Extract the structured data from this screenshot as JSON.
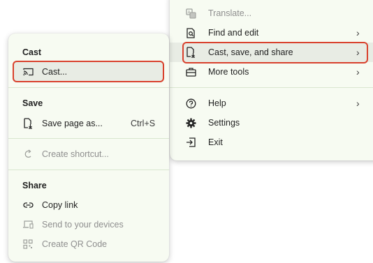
{
  "main_menu": {
    "items": [
      {
        "label": "Translate...",
        "icon": "translate-icon",
        "disabled": true
      },
      {
        "label": "Find and edit",
        "icon": "find-edit-icon",
        "submenu": true
      },
      {
        "label": "Cast, save, and share",
        "icon": "save-share-icon",
        "submenu": true,
        "highlighted": true
      },
      {
        "label": "More tools",
        "icon": "toolbox-icon",
        "submenu": true
      },
      {
        "label": "Help",
        "icon": "help-icon",
        "submenu": true
      },
      {
        "label": "Settings",
        "icon": "gear-icon"
      },
      {
        "label": "Exit",
        "icon": "exit-icon"
      }
    ]
  },
  "sub_menu": {
    "cast_heading": "Cast",
    "cast_item": "Cast...",
    "save_heading": "Save",
    "save_page_item": "Save page as...",
    "save_page_shortcut": "Ctrl+S",
    "create_shortcut_item": "Create shortcut...",
    "share_heading": "Share",
    "copy_link_item": "Copy link",
    "send_devices_item": "Send to your devices",
    "qr_item": "Create QR Code"
  },
  "chevron": "›",
  "accent_color": "#d9412d"
}
